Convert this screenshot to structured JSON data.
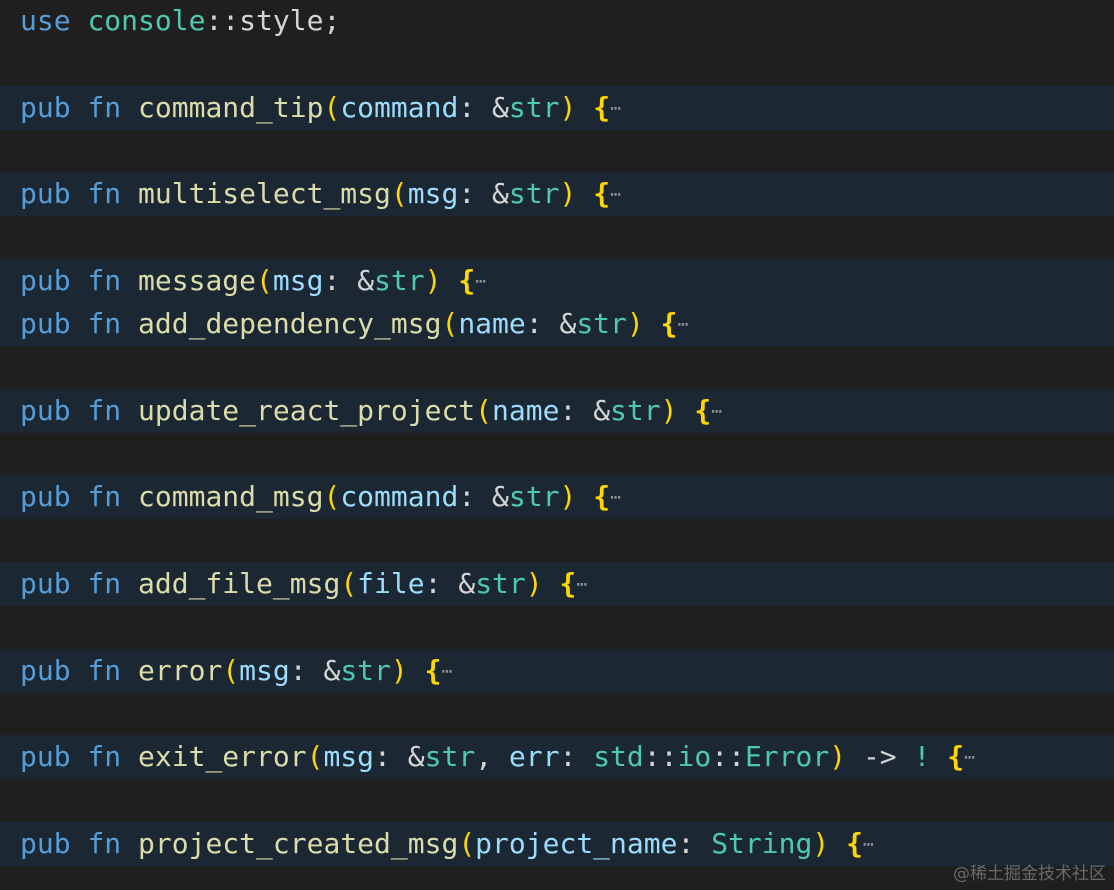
{
  "editor": {
    "lines": [
      {
        "segments": [
          {
            "t": "use",
            "c": "kw"
          },
          {
            "t": " ",
            "c": "punct"
          },
          {
            "t": "console",
            "c": "path"
          },
          {
            "t": "::",
            "c": "punct"
          },
          {
            "t": "style",
            "c": "punct"
          },
          {
            "t": ";",
            "c": "punct"
          }
        ],
        "folded": false
      },
      {
        "segments": [],
        "folded": false
      },
      {
        "segments": [
          {
            "t": "pub",
            "c": "kw"
          },
          {
            "t": " ",
            "c": "punct"
          },
          {
            "t": "fn",
            "c": "kw"
          },
          {
            "t": " ",
            "c": "punct"
          },
          {
            "t": "command_tip",
            "c": "fn"
          },
          {
            "t": "(",
            "c": "paren"
          },
          {
            "t": "command",
            "c": "param"
          },
          {
            "t": ": ",
            "c": "punct"
          },
          {
            "t": "&",
            "c": "punct"
          },
          {
            "t": "str",
            "c": "type"
          },
          {
            "t": ")",
            "c": "paren"
          },
          {
            "t": " ",
            "c": "punct"
          },
          {
            "t": "{",
            "c": "brace"
          },
          {
            "t": "⋯",
            "c": "fold"
          }
        ],
        "folded": true
      },
      {
        "segments": [],
        "folded": false
      },
      {
        "segments": [
          {
            "t": "pub",
            "c": "kw"
          },
          {
            "t": " ",
            "c": "punct"
          },
          {
            "t": "fn",
            "c": "kw"
          },
          {
            "t": " ",
            "c": "punct"
          },
          {
            "t": "multiselect_msg",
            "c": "fn"
          },
          {
            "t": "(",
            "c": "paren"
          },
          {
            "t": "msg",
            "c": "param"
          },
          {
            "t": ": ",
            "c": "punct"
          },
          {
            "t": "&",
            "c": "punct"
          },
          {
            "t": "str",
            "c": "type"
          },
          {
            "t": ")",
            "c": "paren"
          },
          {
            "t": " ",
            "c": "punct"
          },
          {
            "t": "{",
            "c": "brace"
          },
          {
            "t": "⋯",
            "c": "fold"
          }
        ],
        "folded": true
      },
      {
        "segments": [],
        "folded": false
      },
      {
        "segments": [
          {
            "t": "pub",
            "c": "kw"
          },
          {
            "t": " ",
            "c": "punct"
          },
          {
            "t": "fn",
            "c": "kw"
          },
          {
            "t": " ",
            "c": "punct"
          },
          {
            "t": "message",
            "c": "fn"
          },
          {
            "t": "(",
            "c": "paren"
          },
          {
            "t": "msg",
            "c": "param"
          },
          {
            "t": ": ",
            "c": "punct"
          },
          {
            "t": "&",
            "c": "punct"
          },
          {
            "t": "str",
            "c": "type"
          },
          {
            "t": ")",
            "c": "paren"
          },
          {
            "t": " ",
            "c": "punct"
          },
          {
            "t": "{",
            "c": "brace"
          },
          {
            "t": "⋯",
            "c": "fold"
          }
        ],
        "folded": true
      },
      {
        "segments": [
          {
            "t": "pub",
            "c": "kw"
          },
          {
            "t": " ",
            "c": "punct"
          },
          {
            "t": "fn",
            "c": "kw"
          },
          {
            "t": " ",
            "c": "punct"
          },
          {
            "t": "add_dependency_msg",
            "c": "fn"
          },
          {
            "t": "(",
            "c": "paren"
          },
          {
            "t": "name",
            "c": "param"
          },
          {
            "t": ": ",
            "c": "punct"
          },
          {
            "t": "&",
            "c": "punct"
          },
          {
            "t": "str",
            "c": "type"
          },
          {
            "t": ")",
            "c": "paren"
          },
          {
            "t": " ",
            "c": "punct"
          },
          {
            "t": "{",
            "c": "brace"
          },
          {
            "t": "⋯",
            "c": "fold"
          }
        ],
        "folded": true
      },
      {
        "segments": [],
        "folded": false
      },
      {
        "segments": [
          {
            "t": "pub",
            "c": "kw"
          },
          {
            "t": " ",
            "c": "punct"
          },
          {
            "t": "fn",
            "c": "kw"
          },
          {
            "t": " ",
            "c": "punct"
          },
          {
            "t": "update_react_project",
            "c": "fn"
          },
          {
            "t": "(",
            "c": "paren"
          },
          {
            "t": "name",
            "c": "param"
          },
          {
            "t": ": ",
            "c": "punct"
          },
          {
            "t": "&",
            "c": "punct"
          },
          {
            "t": "str",
            "c": "type"
          },
          {
            "t": ")",
            "c": "paren"
          },
          {
            "t": " ",
            "c": "punct"
          },
          {
            "t": "{",
            "c": "brace"
          },
          {
            "t": "⋯",
            "c": "fold"
          }
        ],
        "folded": true
      },
      {
        "segments": [],
        "folded": false
      },
      {
        "segments": [
          {
            "t": "pub",
            "c": "kw"
          },
          {
            "t": " ",
            "c": "punct"
          },
          {
            "t": "fn",
            "c": "kw"
          },
          {
            "t": " ",
            "c": "punct"
          },
          {
            "t": "command_msg",
            "c": "fn"
          },
          {
            "t": "(",
            "c": "paren"
          },
          {
            "t": "command",
            "c": "param"
          },
          {
            "t": ": ",
            "c": "punct"
          },
          {
            "t": "&",
            "c": "punct"
          },
          {
            "t": "str",
            "c": "type"
          },
          {
            "t": ")",
            "c": "paren"
          },
          {
            "t": " ",
            "c": "punct"
          },
          {
            "t": "{",
            "c": "brace"
          },
          {
            "t": "⋯",
            "c": "fold"
          }
        ],
        "folded": true
      },
      {
        "segments": [],
        "folded": false
      },
      {
        "segments": [
          {
            "t": "pub",
            "c": "kw"
          },
          {
            "t": " ",
            "c": "punct"
          },
          {
            "t": "fn",
            "c": "kw"
          },
          {
            "t": " ",
            "c": "punct"
          },
          {
            "t": "add_file_msg",
            "c": "fn"
          },
          {
            "t": "(",
            "c": "paren"
          },
          {
            "t": "file",
            "c": "param"
          },
          {
            "t": ": ",
            "c": "punct"
          },
          {
            "t": "&",
            "c": "punct"
          },
          {
            "t": "str",
            "c": "type"
          },
          {
            "t": ")",
            "c": "paren"
          },
          {
            "t": " ",
            "c": "punct"
          },
          {
            "t": "{",
            "c": "brace"
          },
          {
            "t": "⋯",
            "c": "fold"
          }
        ],
        "folded": true
      },
      {
        "segments": [],
        "folded": false
      },
      {
        "segments": [
          {
            "t": "pub",
            "c": "kw"
          },
          {
            "t": " ",
            "c": "punct"
          },
          {
            "t": "fn",
            "c": "kw"
          },
          {
            "t": " ",
            "c": "punct"
          },
          {
            "t": "error",
            "c": "fn"
          },
          {
            "t": "(",
            "c": "paren"
          },
          {
            "t": "msg",
            "c": "param"
          },
          {
            "t": ": ",
            "c": "punct"
          },
          {
            "t": "&",
            "c": "punct"
          },
          {
            "t": "str",
            "c": "type"
          },
          {
            "t": ")",
            "c": "paren"
          },
          {
            "t": " ",
            "c": "punct"
          },
          {
            "t": "{",
            "c": "brace"
          },
          {
            "t": "⋯",
            "c": "fold"
          }
        ],
        "folded": true
      },
      {
        "segments": [],
        "folded": false
      },
      {
        "segments": [
          {
            "t": "pub",
            "c": "kw"
          },
          {
            "t": " ",
            "c": "punct"
          },
          {
            "t": "fn",
            "c": "kw"
          },
          {
            "t": " ",
            "c": "punct"
          },
          {
            "t": "exit_error",
            "c": "fn"
          },
          {
            "t": "(",
            "c": "paren"
          },
          {
            "t": "msg",
            "c": "param"
          },
          {
            "t": ": ",
            "c": "punct"
          },
          {
            "t": "&",
            "c": "punct"
          },
          {
            "t": "str",
            "c": "type"
          },
          {
            "t": ", ",
            "c": "punct"
          },
          {
            "t": "err",
            "c": "param"
          },
          {
            "t": ": ",
            "c": "punct"
          },
          {
            "t": "std",
            "c": "path"
          },
          {
            "t": "::",
            "c": "punct"
          },
          {
            "t": "io",
            "c": "path"
          },
          {
            "t": "::",
            "c": "punct"
          },
          {
            "t": "Error",
            "c": "type"
          },
          {
            "t": ")",
            "c": "paren"
          },
          {
            "t": " -> ",
            "c": "punct"
          },
          {
            "t": "!",
            "c": "type"
          },
          {
            "t": " ",
            "c": "punct"
          },
          {
            "t": "{",
            "c": "brace"
          },
          {
            "t": "⋯",
            "c": "fold"
          }
        ],
        "folded": true
      },
      {
        "segments": [],
        "folded": false
      },
      {
        "segments": [
          {
            "t": "pub",
            "c": "kw"
          },
          {
            "t": " ",
            "c": "punct"
          },
          {
            "t": "fn",
            "c": "kw"
          },
          {
            "t": " ",
            "c": "punct"
          },
          {
            "t": "project_created_msg",
            "c": "fn"
          },
          {
            "t": "(",
            "c": "paren"
          },
          {
            "t": "project_name",
            "c": "param"
          },
          {
            "t": ": ",
            "c": "punct"
          },
          {
            "t": "String",
            "c": "type"
          },
          {
            "t": ")",
            "c": "paren"
          },
          {
            "t": " ",
            "c": "punct"
          },
          {
            "t": "{",
            "c": "brace"
          },
          {
            "t": "⋯",
            "c": "fold"
          }
        ],
        "folded": true
      }
    ]
  },
  "watermark": "@稀土掘金技术社区",
  "colors": {
    "background": "#1f1f1f",
    "folded_line_bg": "#1b2833",
    "keyword": "#569cd6",
    "function": "#dcdcaa",
    "parameter": "#9cdcfe",
    "type": "#4ec9b0",
    "bracket": "#ffd700"
  }
}
